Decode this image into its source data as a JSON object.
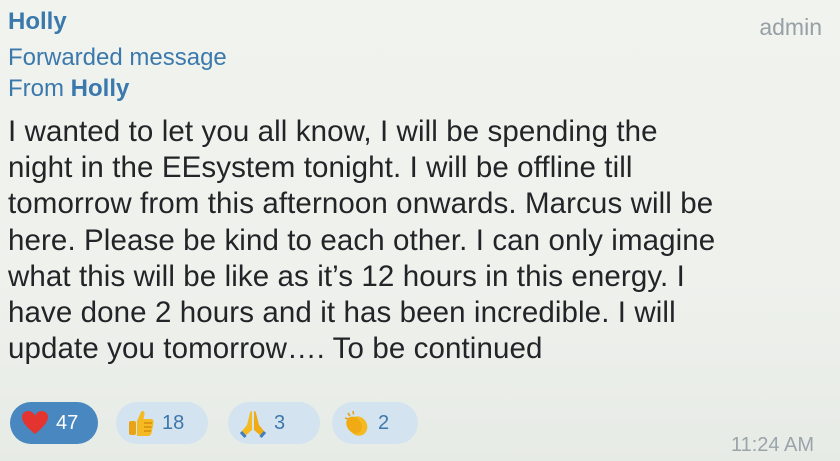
{
  "message": {
    "sender": "Holly",
    "role_badge": "admin",
    "forwarded_label": "Forwarded message",
    "forwarded_from_prefix": "From",
    "forwarded_from_name": "Holly",
    "lines": [
      "I wanted to let you all know, I will be spending the",
      "night in the EEsystem tonight. I will be offline till",
      "tomorrow from this afternoon onwards. Marcus will be",
      "here. Please be kind to each other. I can only imagine",
      "what this will be like as it’s 12 hours in this energy. I",
      "have done 2 hours and it has been incredible. I will",
      "update you tomorrow…. To be continued"
    ],
    "time": "11:24 AM"
  },
  "reactions": [
    {
      "icon": "heart-icon",
      "count": "47",
      "active": true
    },
    {
      "icon": "thumbs-up-icon",
      "count": "18",
      "active": false
    },
    {
      "icon": "praying-hands-icon",
      "count": "3",
      "active": false
    },
    {
      "icon": "clapping-hands-icon",
      "count": "2",
      "active": false
    }
  ],
  "colors": {
    "accent": "#3b79ad",
    "active_chip": "#4887bf",
    "chip": "#d3e3ef",
    "heart": "#e3342f",
    "emoji_yellow": "#f5b921"
  }
}
